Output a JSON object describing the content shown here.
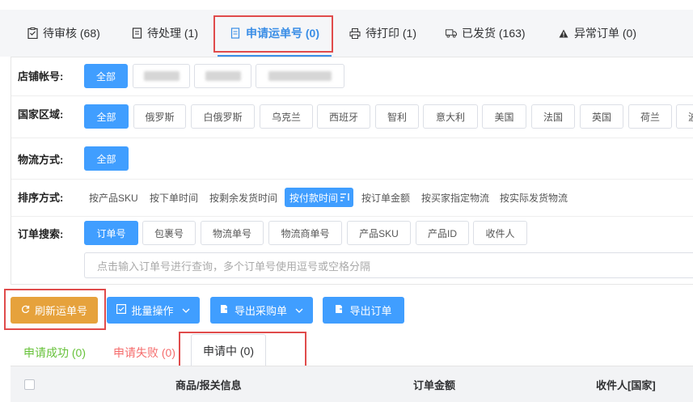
{
  "tabs": [
    {
      "icon": "clipboard-check-icon",
      "label": "待审核 (68)"
    },
    {
      "icon": "document-icon",
      "label": "待处理 (1)"
    },
    {
      "icon": "receipt-icon",
      "label": "申请运单号 (0)"
    },
    {
      "icon": "printer-icon",
      "label": "待打印 (1)"
    },
    {
      "icon": "truck-icon",
      "label": "已发货 (163)"
    },
    {
      "icon": "warning-icon",
      "label": "异常订单 (0)"
    }
  ],
  "filters": {
    "store": {
      "label": "店铺帐号:",
      "all": "全部"
    },
    "country": {
      "label": "国家区域:",
      "options": [
        "全部",
        "俄罗斯",
        "白俄罗斯",
        "乌克兰",
        "西班牙",
        "智利",
        "意大利",
        "美国",
        "法国",
        "英国",
        "荷兰",
        "波"
      ]
    },
    "logistics": {
      "label": "物流方式:",
      "all": "全部"
    },
    "sort": {
      "label": "排序方式:",
      "options": [
        "按产品SKU",
        "按下单时间",
        "按剩余发货时间",
        "按付款时间",
        "按订单金额",
        "按买家指定物流",
        "按实际发货物流"
      ]
    },
    "search": {
      "label": "订单搜索:",
      "types": [
        "订单号",
        "包裹号",
        "物流单号",
        "物流商单号",
        "产品SKU",
        "产品ID",
        "收件人"
      ],
      "placeholder": "点击输入订单号进行查询，多个订单号使用逗号或空格分隔"
    }
  },
  "actions": {
    "refresh": "刷新运单号",
    "batch": "批量操作",
    "export_purchase": "导出采购单",
    "export_orders": "导出订单"
  },
  "status_tabs": {
    "success": "申请成功 (0)",
    "failed": "申请失败 (0)",
    "pending": "申请中 (0)"
  },
  "table": {
    "headers": [
      "商品/报关信息",
      "订单金额",
      "收件人[国家]"
    ]
  },
  "colors": {
    "primary": "#409eff",
    "warning": "#e6a23c",
    "success": "#67c23a",
    "danger": "#f56c6c",
    "highlight_box": "#e04b4b"
  }
}
